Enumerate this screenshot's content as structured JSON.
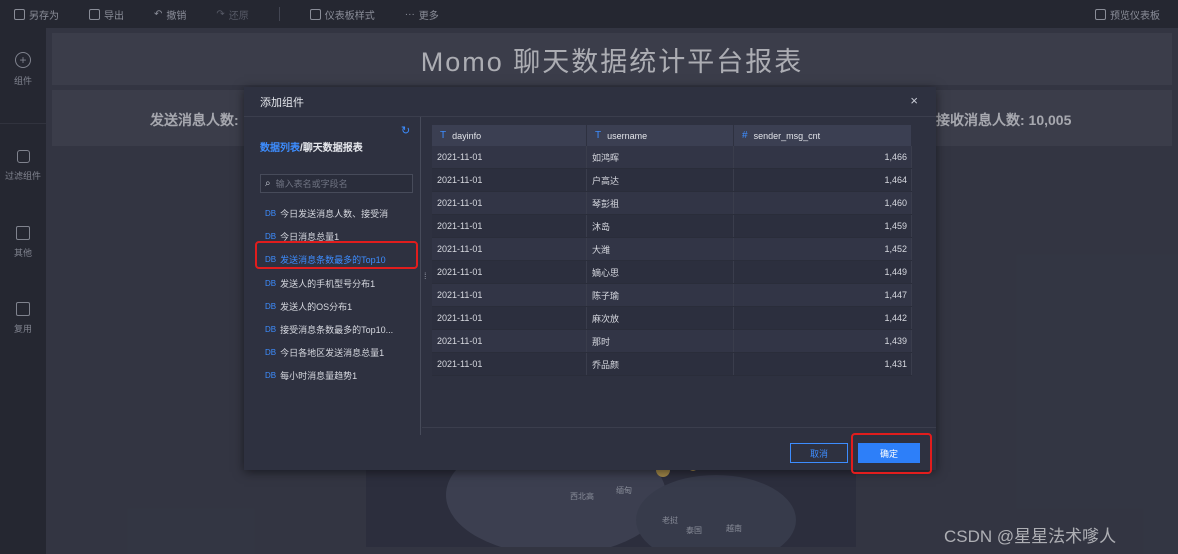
{
  "toolbar": {
    "items": [
      {
        "label": "另存为",
        "icon": "save-as-icon",
        "disabled": false
      },
      {
        "label": "导出",
        "icon": "export-icon",
        "disabled": false
      },
      {
        "label": "撤销",
        "icon": "undo-icon",
        "disabled": false
      },
      {
        "label": "还原",
        "icon": "redo-icon",
        "disabled": true
      },
      {
        "label": "仪表板样式",
        "icon": "style-icon",
        "disabled": false
      },
      {
        "label": "更多",
        "icon": "more-icon",
        "disabled": false
      }
    ],
    "preview_label": "预览仪表板"
  },
  "sidebar": {
    "items": [
      {
        "label": "组件",
        "icon": "plus-circle-icon"
      },
      {
        "label": "过滤组件",
        "icon": "filter-cube-icon"
      },
      {
        "label": "其他",
        "icon": "other-icon"
      },
      {
        "label": "复用",
        "icon": "reuse-icon"
      }
    ]
  },
  "dashboard": {
    "title": "Momo 聊天数据统计平台报表",
    "stat_left": "发送消息人数:",
    "stat_right": "接收消息人数: 10,005",
    "map_labels": [
      "西北高",
      "缅甸",
      "老挝",
      "泰国",
      "越南"
    ]
  },
  "modal": {
    "title": "添加组件",
    "close": "×",
    "breadcrumb_root": "数据列表",
    "breadcrumb_sep": "/",
    "breadcrumb_current": "聊天数据报表",
    "search_placeholder": "输入表名或字段名",
    "db_tag": "DB",
    "tables": [
      "今日发送消息人数、接受消",
      "今日消息总量1",
      "发送消息条数最多的Top10",
      "发送人的手机型号分布1",
      "发送人的OS分布1",
      "接受消息条数最多的Top10...",
      "今日各地区发送消息总量1",
      "每小时消息量趋势1"
    ],
    "selected_index": 2,
    "columns": [
      {
        "type": "T",
        "name": "dayinfo"
      },
      {
        "type": "T",
        "name": "username"
      },
      {
        "type": "#",
        "name": "sender_msg_cnt"
      }
    ],
    "rows": [
      [
        "2021-11-01",
        "如鸿晖",
        "1,466"
      ],
      [
        "2021-11-01",
        "户高达",
        "1,464"
      ],
      [
        "2021-11-01",
        "琴彭祖",
        "1,460"
      ],
      [
        "2021-11-01",
        "沐岛",
        "1,459"
      ],
      [
        "2021-11-01",
        "大潍",
        "1,452"
      ],
      [
        "2021-11-01",
        "嫡心思",
        "1,449"
      ],
      [
        "2021-11-01",
        "陈子瑜",
        "1,447"
      ],
      [
        "2021-11-01",
        "麻次放",
        "1,442"
      ],
      [
        "2021-11-01",
        "那时",
        "1,439"
      ],
      [
        "2021-11-01",
        "乔品颜",
        "1,431"
      ]
    ],
    "cancel_label": "取消",
    "ok_label": "确定"
  },
  "watermark": "CSDN @星星法术嗲人",
  "colors": {
    "accent": "#2d7ff9",
    "highlight": "#e11d1d",
    "panel": "#2e3140"
  }
}
